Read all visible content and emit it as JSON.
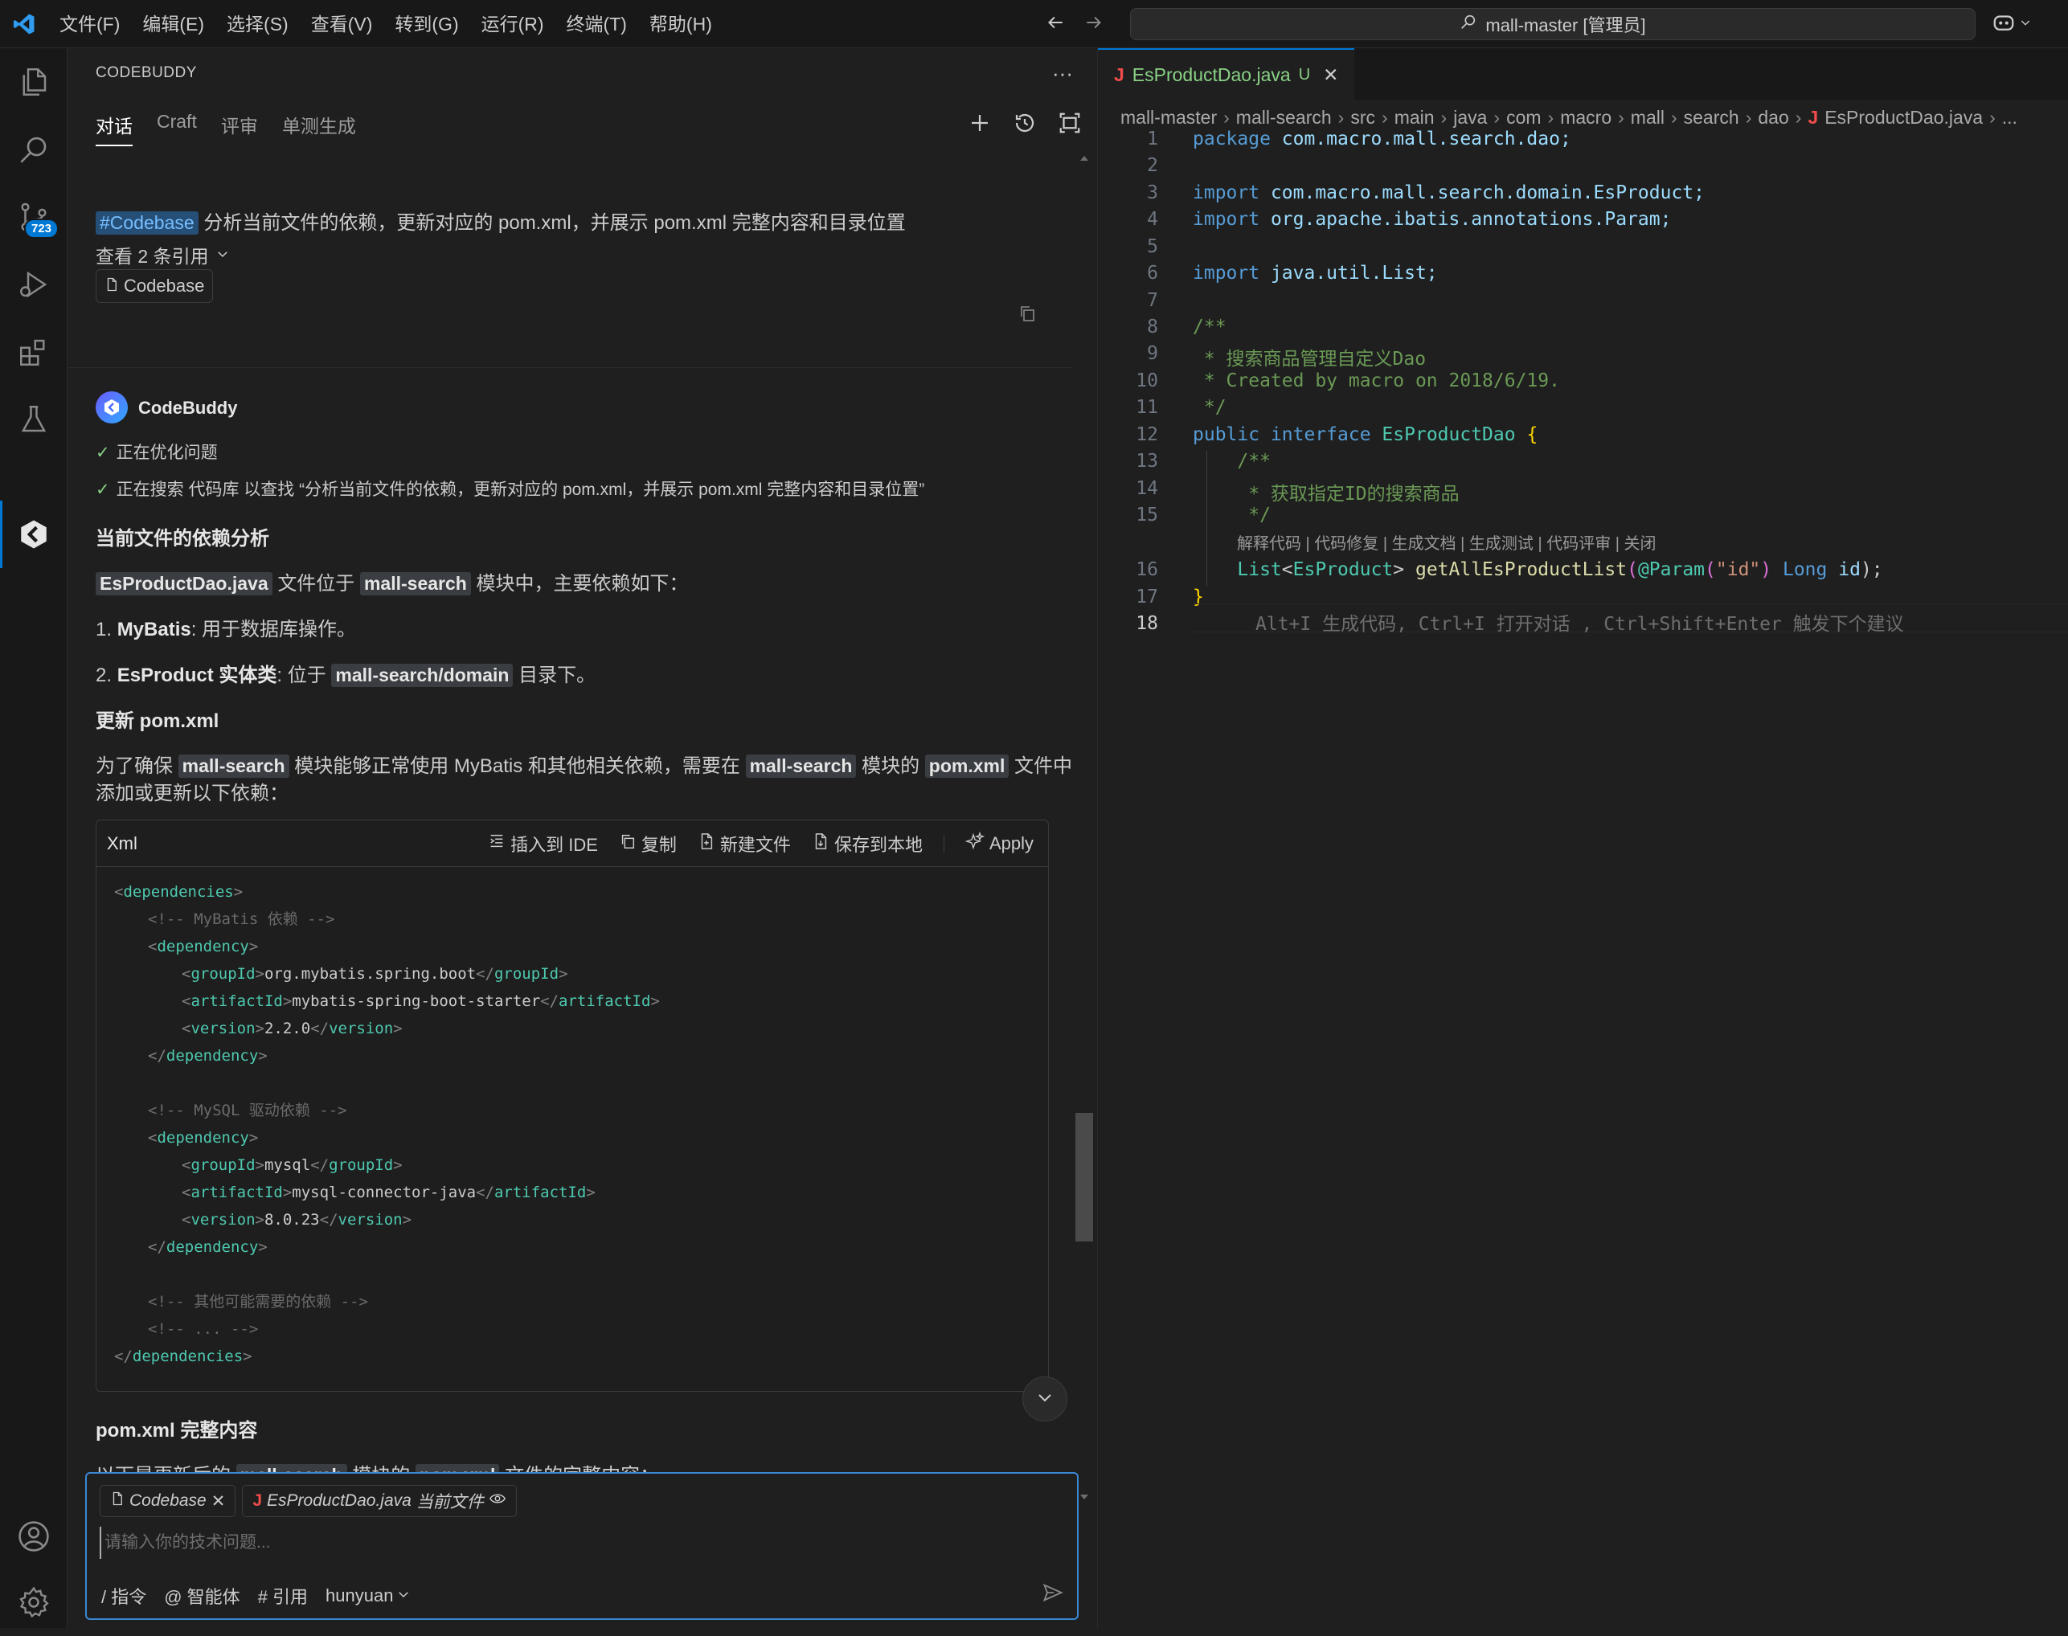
{
  "titlebar": {
    "menus": [
      "文件(F)",
      "编辑(E)",
      "选择(S)",
      "查看(V)",
      "转到(G)",
      "运行(R)",
      "终端(T)",
      "帮助(H)"
    ],
    "search_text": "mall-master [管理员]"
  },
  "activitybar": {
    "scm_badge": "723",
    "items": [
      "files-icon",
      "search-icon",
      "source-control-icon",
      "run-debug-icon",
      "extensions-icon",
      "testing-icon",
      "codebuddy-icon",
      "account-icon",
      "settings-gear-icon"
    ]
  },
  "panel": {
    "title": "CODEBUDDY",
    "tabs": [
      "对话",
      "Craft",
      "评审",
      "单测生成"
    ],
    "active_tab": 0
  },
  "chat": {
    "question_tag": "#Codebase",
    "question_text": "分析当前文件的依赖，更新对应的 pom.xml，并展示 pom.xml 完整内容和目录位置",
    "refs_toggle": "查看 2 条引用",
    "ref_chip": "Codebase",
    "bot_name": "CodeBuddy",
    "steps": [
      "正在优化问题",
      "正在搜索 代码库 以查找 “分析当前文件的依赖，更新对应的 pom.xml，并展示 pom.xml 完整内容和目录位置”"
    ],
    "h1": "当前文件的依赖分析",
    "p1_tag1": "EsProductDao.java",
    "p1_mid": "文件位于",
    "p1_tag2": "mall-search",
    "p1_end": "模块中，主要依赖如下：",
    "li1_num": "1.",
    "li1_bold": "MyBatis",
    "li1_text": ": 用于数据库操作。",
    "li2_num": "2.",
    "li2_bold": "EsProduct 实体类",
    "li2_text": ": 位于",
    "li2_tag": "mall-search/domain",
    "li2_end": "目录下。",
    "h2": "更新 pom.xml",
    "p2_a": "为了确保",
    "p2_tag1": "mall-search",
    "p2_b": "模块能够正常使用 MyBatis 和其他相关依赖，需要在",
    "p2_tag2": "mall-search",
    "p2_c": "模块的",
    "p2_tag3": "pom.xml",
    "p2_d": "文件中",
    "p2_e": "添加或更新以下依赖：",
    "code_lang": "Xml",
    "code_actions": [
      "插入到 IDE",
      "复制",
      "新建文件",
      "保存到本地",
      "Apply"
    ],
    "h3": "pom.xml 完整内容",
    "p3_a": "以下是更新后的",
    "p3_tag1": "mall-search",
    "p3_b": "模块的",
    "p3_tag2": "pom.xml",
    "p3_c": "文件的完整内容："
  },
  "xml_lines": [
    {
      "indent": 0,
      "kind": "open",
      "tag": "dependencies"
    },
    {
      "indent": 1,
      "kind": "comment",
      "text": "<!-- MyBatis 依赖 -->"
    },
    {
      "indent": 1,
      "kind": "open",
      "tag": "dependency"
    },
    {
      "indent": 2,
      "kind": "elem",
      "tag": "groupId",
      "value": "org.mybatis.spring.boot"
    },
    {
      "indent": 2,
      "kind": "elem",
      "tag": "artifactId",
      "value": "mybatis-spring-boot-starter"
    },
    {
      "indent": 2,
      "kind": "elem",
      "tag": "version",
      "value": "2.2.0"
    },
    {
      "indent": 1,
      "kind": "close",
      "tag": "dependency"
    },
    {
      "indent": 0,
      "kind": "blank"
    },
    {
      "indent": 1,
      "kind": "comment",
      "text": "<!-- MySQL 驱动依赖 -->"
    },
    {
      "indent": 1,
      "kind": "open",
      "tag": "dependency"
    },
    {
      "indent": 2,
      "kind": "elem",
      "tag": "groupId",
      "value": "mysql"
    },
    {
      "indent": 2,
      "kind": "elem",
      "tag": "artifactId",
      "value": "mysql-connector-java"
    },
    {
      "indent": 2,
      "kind": "elem",
      "tag": "version",
      "value": "8.0.23"
    },
    {
      "indent": 1,
      "kind": "close",
      "tag": "dependency"
    },
    {
      "indent": 0,
      "kind": "blank"
    },
    {
      "indent": 1,
      "kind": "comment",
      "text": "<!-- 其他可能需要的依赖 -->"
    },
    {
      "indent": 1,
      "kind": "comment",
      "text": "<!-- ... -->"
    },
    {
      "indent": 0,
      "kind": "close",
      "tag": "dependencies"
    }
  ],
  "input": {
    "chip_codebase": "Codebase",
    "chip_file": "EsProductDao.java",
    "chip_file_note": "当前文件",
    "placeholder": "请输入你的技术问题...",
    "tools": [
      "/ 指令",
      "@ 智能体",
      "# 引用",
      "hunyuan"
    ]
  },
  "editor": {
    "tab_label": "EsProductDao.java",
    "tab_status": "U",
    "breadcrumb": [
      "mall-master",
      "mall-search",
      "src",
      "main",
      "java",
      "com",
      "macro",
      "mall",
      "search",
      "dao",
      "EsProductDao.java",
      "..."
    ],
    "codelens": "解释代码 | 代码修复 | 生成文档 | 生成测试 | 代码评审 | 关闭",
    "ghost_text": "Alt+I 生成代码, Ctrl+I 打开对话 , Ctrl+Shift+Enter 触发下个建议",
    "line_numbers": [
      "1",
      "2",
      "3",
      "4",
      "5",
      "6",
      "7",
      "8",
      "9",
      "10",
      "11",
      "12",
      "13",
      "14",
      "15",
      "16",
      "17",
      "18"
    ],
    "code": {
      "l1_kw": "package",
      "l1_rest": " com.macro.mall.search.dao;",
      "l3_kw": "import",
      "l3_rest": " com.macro.mall.search.domain.EsProduct;",
      "l4_kw": "import",
      "l4_rest": " org.apache.ibatis.annotations.Param;",
      "l6_kw": "import",
      "l6_rest": " java.util.List;",
      "l8": "/**",
      "l9": " * 搜索商品管理自定义Dao",
      "l10": " * Created by macro on 2018/6/19.",
      "l11": " */",
      "l12_kw1": "public",
      "l12_kw2": " interface",
      "l12_name": " EsProductDao",
      "l12_br": " {",
      "l13": "    /**",
      "l14": "     * 获取指定ID的搜索商品",
      "l15": "     */",
      "l16_ind": "    ",
      "l16_list": "List",
      "l16_lt": "<",
      "l16_type": "EsProduct",
      "l16_gt": ">",
      "l16_fn": " getAllEsProductList",
      "l16_p1": "(",
      "l16_ann": "@Param",
      "l16_p2": "(",
      "l16_str": "\"id\"",
      "l16_p3": ")",
      "l16_long": " Long",
      "l16_id": " id",
      "l16_end": ");",
      "l17": "}"
    }
  }
}
